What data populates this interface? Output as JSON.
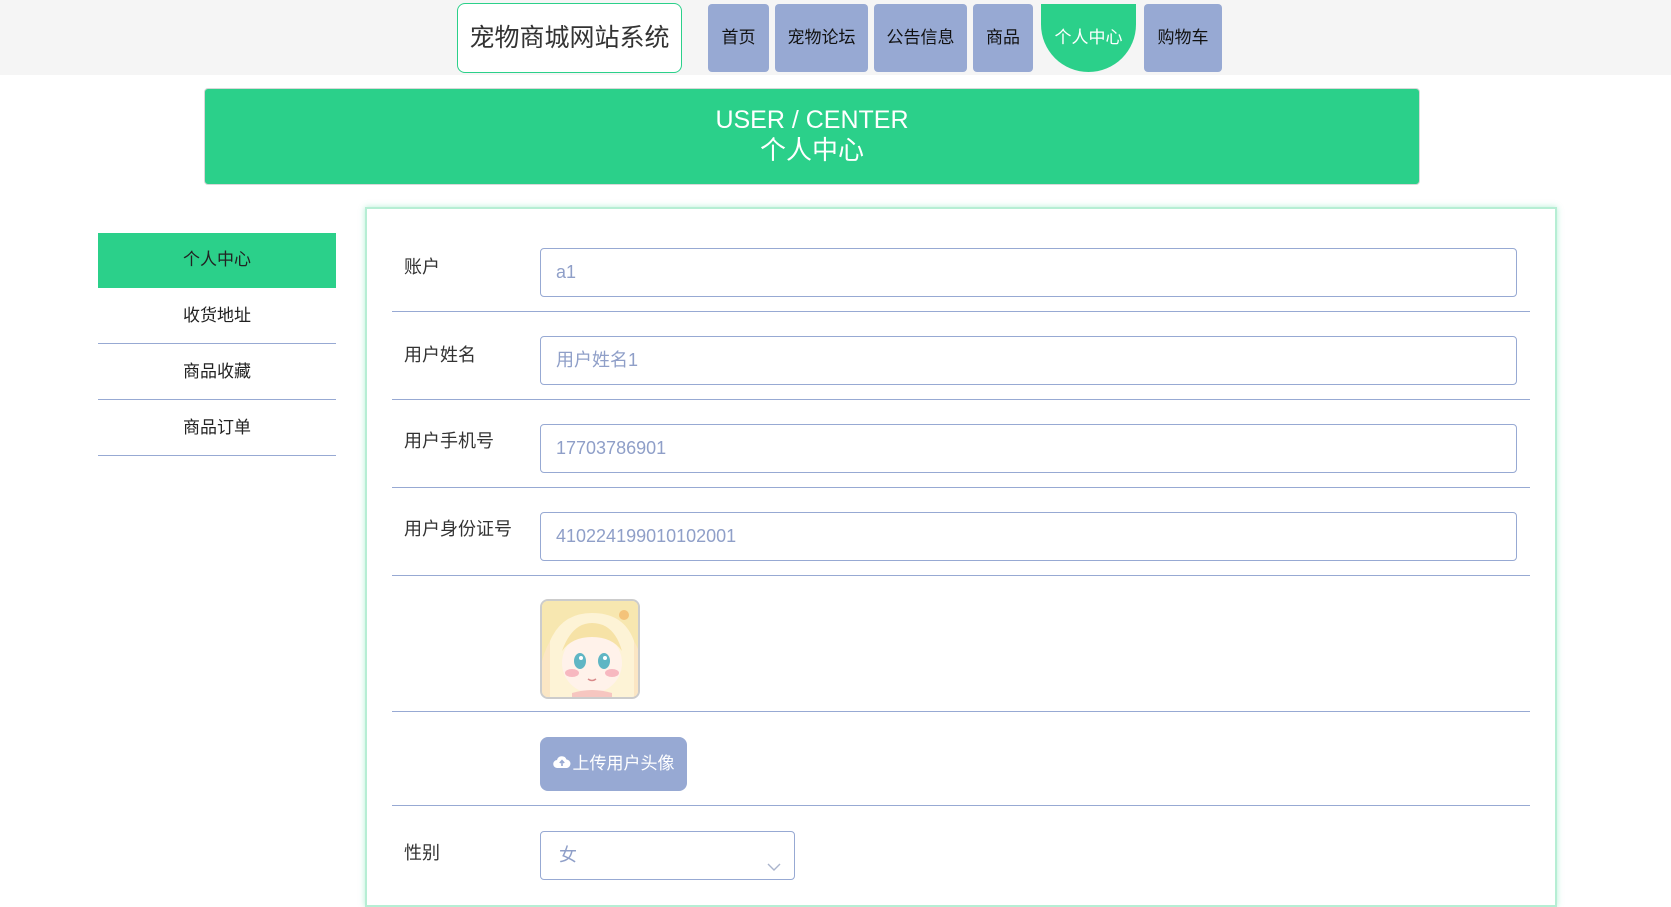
{
  "nav": {
    "brand": "宠物商城网站系统",
    "items": [
      {
        "label": "首页"
      },
      {
        "label": "宠物论坛"
      },
      {
        "label": "公告信息"
      },
      {
        "label": "商品"
      },
      {
        "label": "个人中心"
      },
      {
        "label": "购物车"
      }
    ],
    "active_index": 4
  },
  "banner": {
    "en": "USER / CENTER",
    "zh": "个人中心"
  },
  "side_menu": {
    "items": [
      {
        "label": "个人中心"
      },
      {
        "label": "收货地址"
      },
      {
        "label": "商品收藏"
      },
      {
        "label": "商品订单"
      }
    ],
    "active_index": 0
  },
  "form": {
    "account": {
      "label": "账户",
      "value": "a1"
    },
    "name": {
      "label": "用户姓名",
      "value": "用户姓名1"
    },
    "phone": {
      "label": "用户手机号",
      "value": "17703786901"
    },
    "id_card": {
      "label": "用户身份证号",
      "value": "410224199010102001"
    },
    "upload_label": "上传用户头像",
    "gender": {
      "label": "性别",
      "value": "女"
    }
  },
  "icons": {
    "upload": "cloud-upload-icon",
    "select": "chevron-down-icon"
  },
  "colors": {
    "accent": "#2bd08a",
    "nav_bg": "#97a9d3",
    "border": "#97a9d3",
    "field_text": "#8f9fc8"
  }
}
